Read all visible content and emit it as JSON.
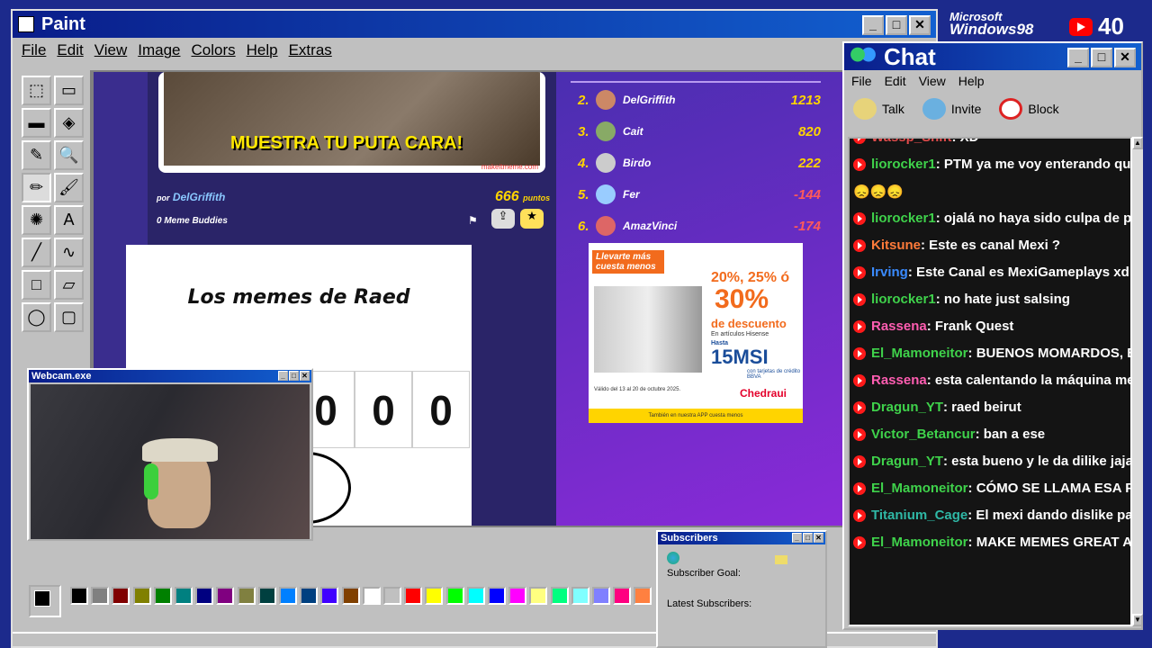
{
  "paint": {
    "title": "Paint",
    "menu": [
      "File",
      "Edit",
      "View",
      "Image",
      "Colors",
      "Help",
      "Extras"
    ],
    "tools": [
      "free-select",
      "rect-select",
      "eraser",
      "fill",
      "color-picker",
      "magnifier",
      "pencil",
      "brush",
      "airbrush",
      "text",
      "line",
      "curve",
      "rectangle",
      "polygon",
      "ellipse",
      "rounded-rect"
    ],
    "palette": [
      "#000000",
      "#808080",
      "#800000",
      "#808000",
      "#008000",
      "#008080",
      "#000080",
      "#800080",
      "#808040",
      "#004040",
      "#0080ff",
      "#004080",
      "#4000ff",
      "#804000",
      "#ffffff",
      "#c0c0c0",
      "#ff0000",
      "#ffff00",
      "#00ff00",
      "#00ffff",
      "#0000ff",
      "#ff00ff",
      "#ffff80",
      "#00ff80",
      "#80ffff",
      "#8080ff",
      "#ff0080",
      "#ff8040"
    ]
  },
  "browser": {
    "meme_caption": "MUESTRA TU PUTA CARA!",
    "watermark": "makeitmeme.com",
    "author_prefix": "por",
    "author": "DelGriffith",
    "buddies": "0 Meme Buddies",
    "points": "666",
    "points_label": "puntos",
    "card_title": "Los memes de Raed",
    "scores": [
      "0",
      "0",
      "0"
    ],
    "leaderboard": [
      {
        "rank": "2.",
        "name": "DelGriffith",
        "pts": "1213"
      },
      {
        "rank": "3.",
        "name": "Cait",
        "pts": "820"
      },
      {
        "rank": "4.",
        "name": "Birdo",
        "pts": "222"
      },
      {
        "rank": "5.",
        "name": "Fer",
        "pts": "-144"
      },
      {
        "rank": "6.",
        "name": "AmazVinci",
        "pts": "-174"
      }
    ],
    "ad": {
      "line1": "Llevarte más",
      "line2": "cuesta menos",
      "offer": "20%, 25% ó",
      "big": "30%",
      "desc": "de descuento",
      "sub": "En artículos Hisense",
      "msi_prefix": "Hasta",
      "msi": "15MSI",
      "msi_note": "con tarjetas de crédito BBVA",
      "validity": "Válido del 13 al 20 de octubre 2025.",
      "brand": "Chedraui",
      "footer": "También en nuestra APP cuesta menos"
    }
  },
  "webcam": {
    "title": "Webcam.exe"
  },
  "subscribers": {
    "title": "Subscribers",
    "goal": "Subscriber Goal:",
    "latest": "Latest Subscribers:"
  },
  "chat": {
    "title": "Chat",
    "menu": [
      "File",
      "Edit",
      "View",
      "Help"
    ],
    "toolbar": {
      "talk": "Talk",
      "invite": "Invite",
      "block": "Block"
    },
    "messages": [
      {
        "user": "Wassp_Shift",
        "color": "#e14b4b",
        "text": ": XD"
      },
      {
        "user": "liorocker1",
        "color": "#3fd24b",
        "text": ": PTM ya me voy enterando que b"
      },
      {
        "user": "",
        "color": "#ffd24b",
        "text": "😞😞😞"
      },
      {
        "user": "liorocker1",
        "color": "#3fd24b",
        "text": ": ojalá no haya sido culpa de paw"
      },
      {
        "user": "Kitsune",
        "color": "#ff7b3a",
        "text": ": Este es canal Mexi ?"
      },
      {
        "user": "Irving",
        "color": "#3a8bff",
        "text": ": Este Canal es MexiGameplays xd"
      },
      {
        "user": "liorocker1",
        "color": "#3fd24b",
        "text": ": no hate just salsing"
      },
      {
        "user": "Rassena",
        "color": "#ff5db1",
        "text": ": Frank Quest"
      },
      {
        "user": "El_Mamoneitor",
        "color": "#3fd24b",
        "text": ": BUENOS MOMARDOS, BA"
      },
      {
        "user": "Rassena",
        "color": "#ff5db1",
        "text": ": esta calentando la máquina mem"
      },
      {
        "user": "Dragun_YT",
        "color": "#3fd24b",
        "text": ": raed beirut"
      },
      {
        "user": "Victor_Betancur",
        "color": "#3fd24b",
        "text": ": ban a ese"
      },
      {
        "user": "Dragun_YT",
        "color": "#3fd24b",
        "text": ": esta bueno y le da dilike jaja"
      },
      {
        "user": "El_Mamoneitor",
        "color": "#3fd24b",
        "text": ": CÓMO SE LLAMA ESA PÁG"
      },
      {
        "user": "Titanium_Cage",
        "color": "#2fb8a6",
        "text": ": El mexi dando dislike para"
      },
      {
        "user": "El_Mamoneitor",
        "color": "#3fd24b",
        "text": ": MAKE MEMES GREAT AGA"
      }
    ]
  },
  "overlay": {
    "os_brand_1": "Microsoft",
    "os_brand_2": "Windows98",
    "subscriber_count": "40"
  }
}
